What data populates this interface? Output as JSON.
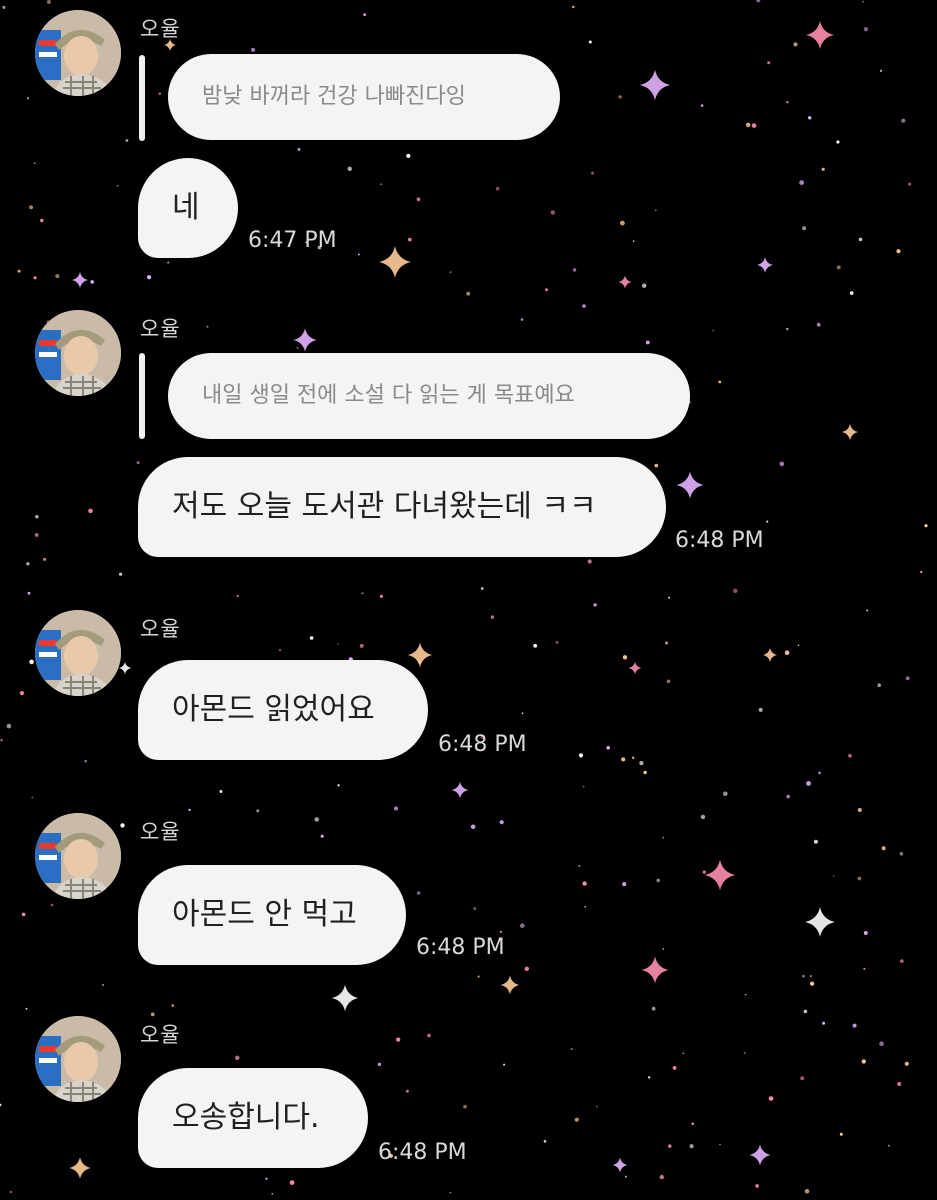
{
  "background": {
    "color": "#000000",
    "star_colors": [
      "#ffffff",
      "#e6b3ff",
      "#ff8fb0",
      "#ffcc99"
    ]
  },
  "messages": [
    {
      "sender": "오율",
      "reply_quote": "밤낮 바꺼라 건강 나빠진다잉",
      "text": "네",
      "time": "6:47 PM"
    },
    {
      "sender": "오율",
      "reply_quote": "내일 생일 전에 소설 다 읽는 게 목표예요",
      "text": "저도 오늘 도서관 다녀왔는데 ㅋㅋ",
      "time": "6:48 PM"
    },
    {
      "sender": "오율",
      "text": "아몬드 읽었어요",
      "time": "6:48 PM"
    },
    {
      "sender": "오율",
      "text": "아몬드 안 먹고",
      "time": "6:48 PM"
    },
    {
      "sender": "오율",
      "text": "오송합니다.",
      "time": "6:48 PM"
    }
  ]
}
